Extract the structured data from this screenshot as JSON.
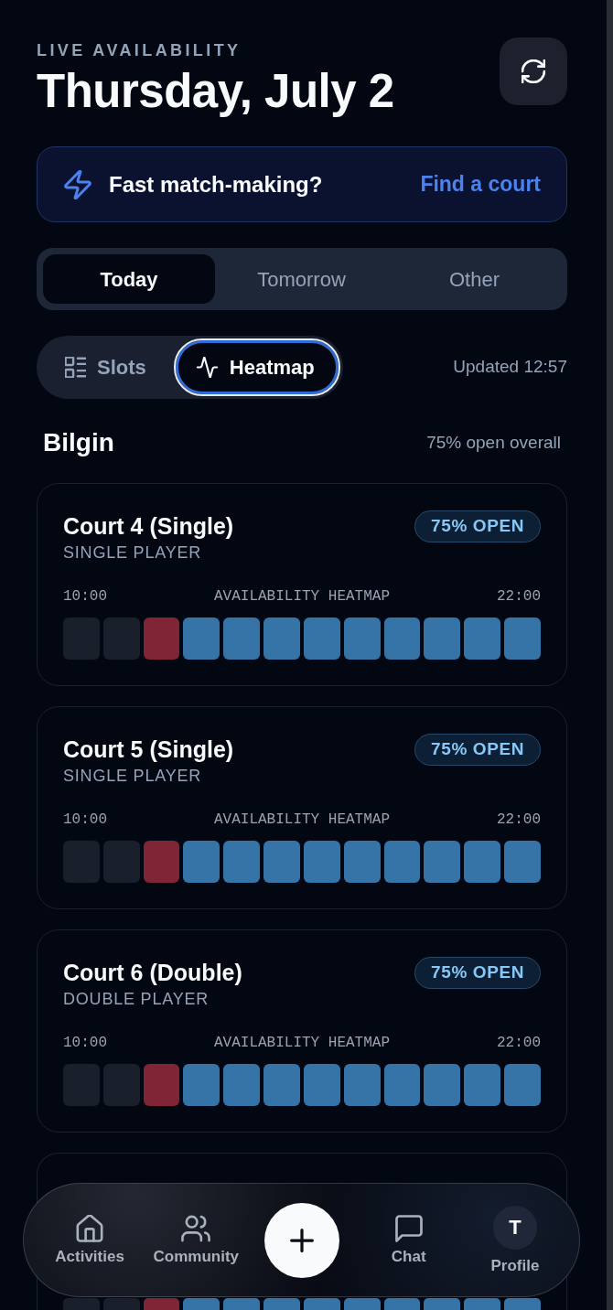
{
  "header": {
    "eyebrow": "LIVE AVAILABILITY",
    "title": "Thursday, July 2"
  },
  "promo": {
    "text": "Fast match-making?",
    "link": "Find a court"
  },
  "day_tabs": [
    {
      "label": "Today",
      "selected": true
    },
    {
      "label": "Tomorrow",
      "selected": false
    },
    {
      "label": "Other",
      "selected": false
    }
  ],
  "view_toggle": [
    {
      "label": "Slots",
      "selected": false
    },
    {
      "label": "Heatmap",
      "selected": true
    }
  ],
  "updated": "Updated 12:57",
  "venue": {
    "name": "Bilgin",
    "summary": "75% open overall"
  },
  "courts": [
    {
      "name": "Court 4 (Single)",
      "type": "SINGLE PLAYER",
      "badge": "75% OPEN",
      "heatmap": {
        "start": "10:00",
        "label": "AVAILABILITY HEATMAP",
        "end": "22:00",
        "cells": [
          {
            "color": "#1a1f2c"
          },
          {
            "color": "#1a1f2c"
          },
          {
            "color": "#7f2535"
          },
          {
            "color": "#3673a6"
          },
          {
            "color": "#3673a6"
          },
          {
            "color": "#3673a6"
          },
          {
            "color": "#3673a6"
          },
          {
            "color": "#3673a6"
          },
          {
            "color": "#3673a6"
          },
          {
            "color": "#3673a6"
          },
          {
            "color": "#3673a6"
          },
          {
            "color": "#3673a6"
          }
        ]
      }
    },
    {
      "name": "Court 5 (Single)",
      "type": "SINGLE PLAYER",
      "badge": "75% OPEN",
      "heatmap": {
        "start": "10:00",
        "label": "AVAILABILITY HEATMAP",
        "end": "22:00",
        "cells": [
          {
            "color": "#1a1f2c"
          },
          {
            "color": "#1a1f2c"
          },
          {
            "color": "#7f2535"
          },
          {
            "color": "#3673a6"
          },
          {
            "color": "#3673a6"
          },
          {
            "color": "#3673a6"
          },
          {
            "color": "#3673a6"
          },
          {
            "color": "#3673a6"
          },
          {
            "color": "#3673a6"
          },
          {
            "color": "#3673a6"
          },
          {
            "color": "#3673a6"
          },
          {
            "color": "#3673a6"
          }
        ]
      }
    },
    {
      "name": "Court 6 (Double)",
      "type": "DOUBLE PLAYER",
      "badge": "75% OPEN",
      "heatmap": {
        "start": "10:00",
        "label": "AVAILABILITY HEATMAP",
        "end": "22:00",
        "cells": [
          {
            "color": "#1a1f2c"
          },
          {
            "color": "#1a1f2c"
          },
          {
            "color": "#7f2535"
          },
          {
            "color": "#3673a6"
          },
          {
            "color": "#3673a6"
          },
          {
            "color": "#3673a6"
          },
          {
            "color": "#3673a6"
          },
          {
            "color": "#3673a6"
          },
          {
            "color": "#3673a6"
          },
          {
            "color": "#3673a6"
          },
          {
            "color": "#3673a6"
          },
          {
            "color": "#3673a6"
          }
        ]
      }
    },
    {
      "heatmap": {
        "cells": [
          {
            "color": "#1a1f2c"
          },
          {
            "color": "#1a1f2c"
          },
          {
            "color": "#7f2535"
          },
          {
            "color": "#3673a6"
          },
          {
            "color": "#3673a6"
          },
          {
            "color": "#3673a6"
          },
          {
            "color": "#3673a6"
          },
          {
            "color": "#3673a6"
          },
          {
            "color": "#3673a6"
          },
          {
            "color": "#3673a6"
          },
          {
            "color": "#3673a6"
          },
          {
            "color": "#3673a6"
          }
        ]
      }
    }
  ],
  "nav": [
    {
      "kind": "tab",
      "label": "Activities"
    },
    {
      "kind": "tab",
      "label": "Community"
    },
    {
      "kind": "action"
    },
    {
      "kind": "tab",
      "label": "Chat"
    },
    {
      "kind": "profile",
      "label": "Profile",
      "initial": "T"
    }
  ]
}
